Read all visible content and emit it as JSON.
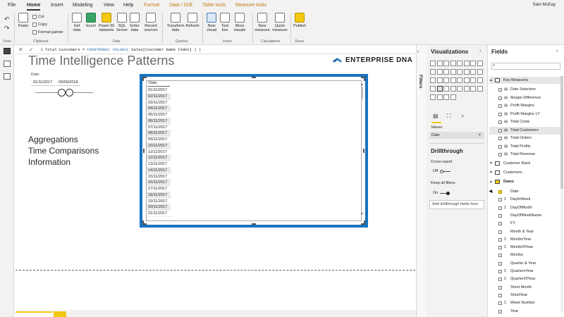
{
  "menu": {
    "tabs": [
      {
        "label": "File"
      },
      {
        "label": "Home"
      },
      {
        "label": "Insert"
      },
      {
        "label": "Modeling"
      },
      {
        "label": "View"
      },
      {
        "label": "Help"
      },
      {
        "label": "Format"
      },
      {
        "label": "Data / Drill"
      },
      {
        "label": "Table tools"
      },
      {
        "label": "Measure tools"
      }
    ],
    "user": "Sam McKay"
  },
  "ribbon": {
    "paste": "Paste",
    "cut": "Cut",
    "copy": "Copy",
    "format_painter": "Format painter",
    "get_data": "Get data",
    "excel": "Excel",
    "power_bi_datasets": "Power BI datasets",
    "sql_server": "SQL Server",
    "enter_data": "Enter data",
    "recent_sources": "Recent sources",
    "transform_data": "Transform data",
    "refresh": "Refresh",
    "new_visual": "New visual",
    "text_box": "Text box",
    "more_visuals": "More visuals",
    "new_measure": "New measure",
    "quick_measure": "Quick measure",
    "publish": "Publish",
    "groups": {
      "undo": "Undo",
      "clipboard": "Clipboard",
      "data": "Data",
      "queries": "Queries",
      "insert": "Insert",
      "calculations": "Calculations",
      "share": "Share"
    }
  },
  "formula_bar": {
    "prefix": "1 Total Customers = ",
    "fn1": "COUNTROWS(",
    "mid": " ",
    "fn2": "VALUES(",
    "rest": " Sales[Customer Name Index] ) )"
  },
  "canvas": {
    "page_title": "Time Intelligence Patterns",
    "logo_text": "ENTERPRISE DNA",
    "slicer_label": "Date",
    "date_start": "01/11/2017",
    "date_end": "03/06/2018",
    "headings": [
      "Aggregations",
      "Time Comparisons",
      "Information"
    ]
  },
  "table_visual": {
    "column": "Date",
    "rows": [
      "01/11/2017",
      "02/11/2017",
      "03/11/2017",
      "04/11/2017",
      "05/11/2017",
      "06/11/2017",
      "07/11/2017",
      "08/11/2017",
      "09/11/2017",
      "10/11/2017",
      "11/11/2017",
      "12/11/2017",
      "13/11/2017",
      "14/11/2017",
      "15/11/2017",
      "16/11/2017",
      "17/11/2017",
      "18/11/2017",
      "19/11/2017",
      "20/11/2017",
      "21/11/2017"
    ]
  },
  "filters": {
    "label": "Filters"
  },
  "visualizations": {
    "title": "Visualizations",
    "values_label": "Values",
    "values_field": "Date",
    "drillthrough": "Drillthrough",
    "cross_report": "Cross-report",
    "cross_report_state": "Off",
    "keep_all_filters": "Keep all filters",
    "keep_all_filters_state": "On",
    "add_drill": "Add drillthrough fields here"
  },
  "fields": {
    "title": "Fields",
    "tables": {
      "key_measures": "Key Measures",
      "customer_rank": "Customer Rank",
      "customers": "Customers",
      "dates": "Dates"
    },
    "measures": [
      "Date Selection",
      "Margin Difference",
      "Profit Margins",
      "Profit Margins LY",
      "Total Costs",
      "Total Customers",
      "Total Orders",
      "Total Profits",
      "Total Revenue"
    ],
    "date_fields": [
      {
        "type": "",
        "name": "Date"
      },
      {
        "type": "Σ",
        "name": "DayInWeek"
      },
      {
        "type": "Σ",
        "name": "DayOfMonth"
      },
      {
        "type": "",
        "name": "DayOfWeekName"
      },
      {
        "type": "",
        "name": "FY"
      },
      {
        "type": "",
        "name": "Month & Year"
      },
      {
        "type": "Σ",
        "name": "MonthnYear"
      },
      {
        "type": "Σ",
        "name": "MonthOfYear"
      },
      {
        "type": "",
        "name": "Months"
      },
      {
        "type": "",
        "name": "Quarter & Year"
      },
      {
        "type": "Σ",
        "name": "QuarternYear"
      },
      {
        "type": "Σ",
        "name": "QuarterOfYear"
      },
      {
        "type": "",
        "name": "Short Month"
      },
      {
        "type": "",
        "name": "ShortYear"
      },
      {
        "type": "Σ",
        "name": "Week Number"
      },
      {
        "type": "",
        "name": "Year"
      }
    ]
  },
  "colors": {
    "accent_yellow": "#f2c811",
    "selection_blue": "#1773c1",
    "ribbon_bg": "#f3f2f1"
  }
}
